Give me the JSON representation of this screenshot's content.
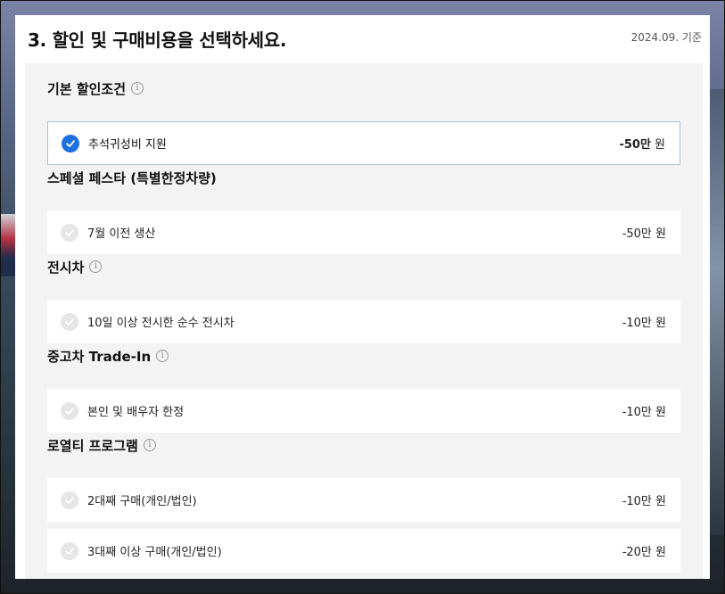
{
  "header": {
    "title": "3. 할인 및 구매비용을 선택하세요.",
    "base_date": "2024.09. 기준"
  },
  "sections": [
    {
      "title": "기본 할인조건",
      "info": "i",
      "options": [
        {
          "label": "추석귀성비 지원",
          "amount_num": "-50만",
          "amount_unit": " 원",
          "selected": true
        }
      ]
    },
    {
      "title": "스페셜 페스타 (특별한정차량)",
      "options": [
        {
          "label": "7월 이전 생산",
          "amount_num": "-50만",
          "amount_unit": " 원",
          "selected": false
        }
      ]
    },
    {
      "title": "전시차",
      "info": "i",
      "options": [
        {
          "label": "10일 이상 전시한 순수 전시차",
          "amount_num": "-10만",
          "amount_unit": " 원",
          "selected": false
        }
      ]
    },
    {
      "title": "중고차 Trade-In",
      "info": "i",
      "options": [
        {
          "label": "본인 및 배우자 한정",
          "amount_num": "-10만",
          "amount_unit": " 원",
          "selected": false
        }
      ]
    },
    {
      "title": "로열티 프로그램",
      "info": "i",
      "options": [
        {
          "label": "2대째 구매(개인/법인)",
          "amount_num": "-10만",
          "amount_unit": " 원",
          "selected": false
        },
        {
          "label": "3대째 이상 구매(개인/법인)",
          "amount_num": "-20만",
          "amount_unit": " 원",
          "selected": false
        }
      ]
    }
  ],
  "colors": {
    "accent": "#1e6fe0",
    "selected_border": "#a9c0d8",
    "content_bg": "#f3f3f3"
  }
}
